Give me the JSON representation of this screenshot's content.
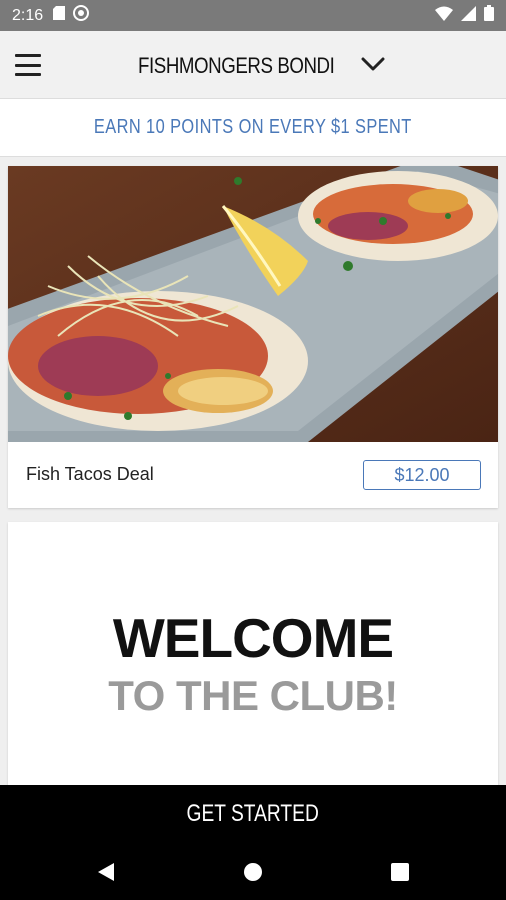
{
  "status_bar": {
    "time": "2:16",
    "icons": [
      "sd-card-icon",
      "sync-icon",
      "wifi-icon",
      "signal-icon",
      "battery-icon"
    ]
  },
  "header": {
    "store_name": "FISHMONGERS BONDI",
    "menu_icon": "hamburger-menu-icon",
    "dropdown_icon": "chevron-down-icon"
  },
  "promo": {
    "text": "EARN 10 POINTS ON EVERY $1 SPENT",
    "color": "#4a78b8"
  },
  "deal": {
    "name": "Fish Tacos Deal",
    "price": "$12.00"
  },
  "welcome": {
    "title": "WELCOME",
    "subtitle": "TO THE CLUB!"
  },
  "cta": {
    "label": "GET STARTED"
  },
  "nav": {
    "icons": [
      "back-icon",
      "home-icon",
      "recents-icon"
    ]
  }
}
